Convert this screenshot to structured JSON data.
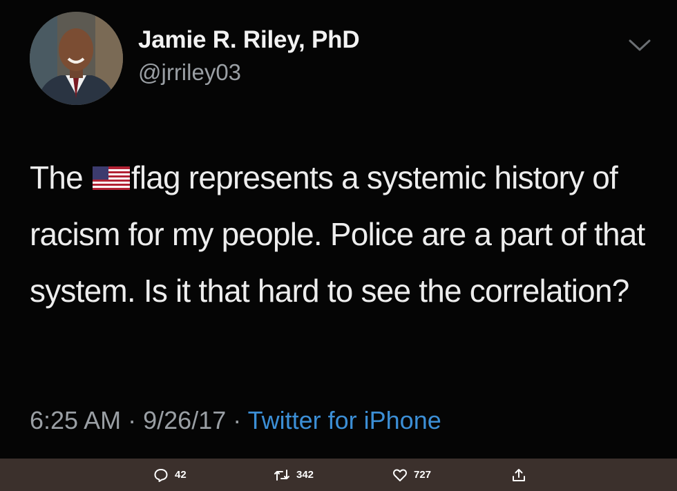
{
  "tweet": {
    "author_name": "Jamie R. Riley, PhD",
    "author_handle": "@jrriley03",
    "text_part1": "The ",
    "flag_icon": "us-flag-icon",
    "text_part2": "flag represents a systemic history of racism for my people. Police are a part of that system. Is it that hard to see the correlation?",
    "time": "6:25 AM",
    "date": "9/26/17",
    "separator": "·",
    "source": "Twitter for iPhone"
  },
  "actions": {
    "reply_count": "42",
    "retweet_count": "342",
    "like_count": "727"
  },
  "colors": {
    "background": "#050505",
    "text": "#ededed",
    "secondary_text": "#9a9fa4",
    "link": "#3c8fd6",
    "action_bar": "#3b302c"
  }
}
